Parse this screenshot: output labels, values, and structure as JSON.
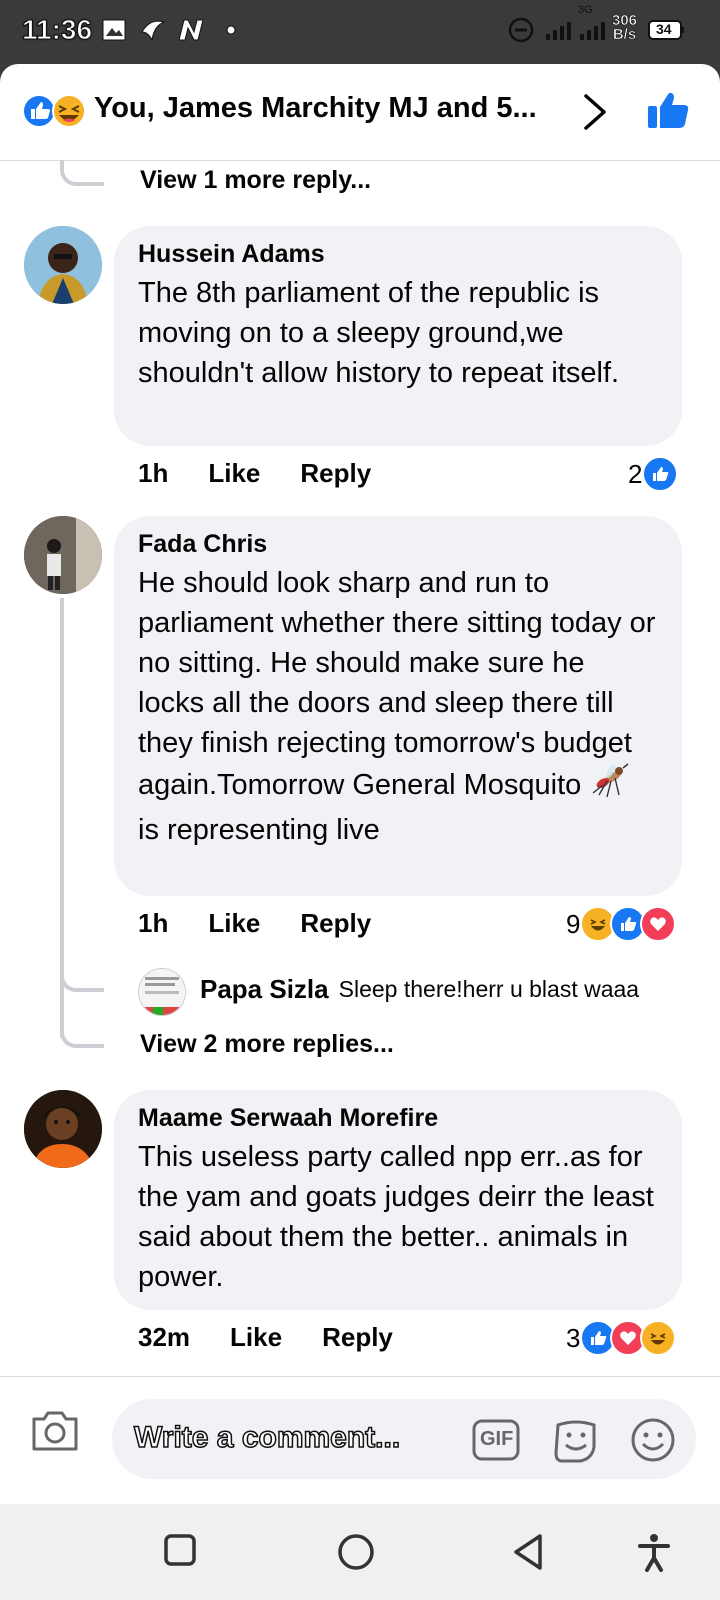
{
  "status": {
    "time": "11:36",
    "network": "3G",
    "speed_top": "306",
    "speed_bottom": "B/s",
    "battery": "34"
  },
  "header": {
    "title": "You, James Marchity MJ and 5..."
  },
  "thread": {
    "view_more_top": "View 1 more reply...",
    "view_more_mid": "View 2 more replies..."
  },
  "comments": [
    {
      "name": "Hussein Adams",
      "text": "The 8th parliament of the republic is moving on to a sleepy ground,we shouldn't allow history to repeat itself.",
      "time": "1h",
      "like": "Like",
      "reply": "Reply",
      "reaction_count": "2"
    },
    {
      "name": "Fada Chris",
      "text_a": "He should look sharp and run to parliament whether there sitting today or no sitting. He should make sure he locks all the doors and sleep there till they finish rejecting tomorrow's budget again.Tomorrow General Mosquito ",
      "text_b": " is representing live",
      "time": "1h",
      "like": "Like",
      "reply": "Reply",
      "reaction_count": "9"
    },
    {
      "name": "Maame Serwaah Morefire",
      "text": "This useless party called npp err..as for the yam and goats judges deirr the least said about them the better.. animals in power.",
      "time": "32m",
      "like": "Like",
      "reply": "Reply",
      "reaction_count": "3"
    }
  ],
  "nested_reply": {
    "name": "Papa Sizla",
    "text": "Sleep there!herr  u blast waaa"
  },
  "composer": {
    "placeholder": "Write a comment...",
    "gif_label": "GIF"
  },
  "colors": {
    "like_blue": "#1877f2",
    "love_red": "#f33e58",
    "haha_yellow": "#f7b125",
    "bubble": "#f0f2f5"
  }
}
